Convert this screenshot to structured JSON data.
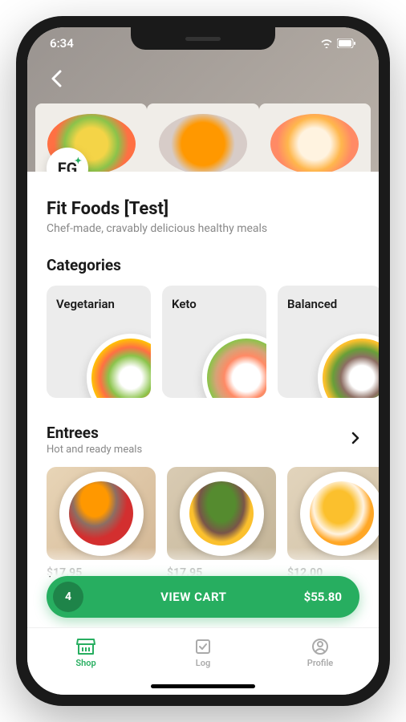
{
  "status": {
    "time": "6:34"
  },
  "store": {
    "badge": "FG",
    "title": "Fit Foods [Test]",
    "tagline": "Chef-made, cravably delicious healthy meals"
  },
  "sections": {
    "categories_title": "Categories",
    "entrees_title": "Entrees",
    "entrees_subtitle": "Hot and ready meals"
  },
  "categories": [
    {
      "name": "Vegetarian"
    },
    {
      "name": "Keto"
    },
    {
      "name": "Balanced"
    }
  ],
  "entrees": [
    {
      "price": "$17.95"
    },
    {
      "price": "$17.95"
    },
    {
      "price": "$12.00"
    }
  ],
  "cart": {
    "count": "4",
    "label": "VIEW CART",
    "total": "$55.80"
  },
  "tabs": {
    "shop": "Shop",
    "log": "Log",
    "profile": "Profile"
  }
}
